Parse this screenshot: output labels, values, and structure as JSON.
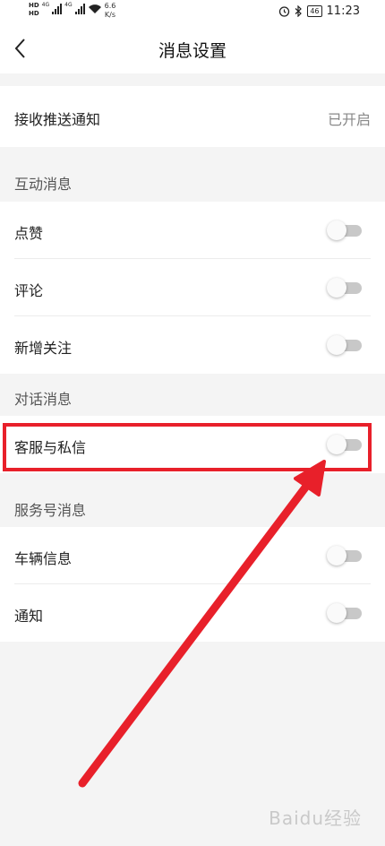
{
  "status_bar": {
    "network_label_1": "HD",
    "network_label_2": "HD",
    "signal_1": "4G",
    "signal_2": "4G",
    "speed_value": "6.6",
    "speed_unit": "K/s",
    "battery": "46",
    "time": "11:23"
  },
  "header": {
    "title": "消息设置"
  },
  "push": {
    "label": "接收推送通知",
    "value": "已开启"
  },
  "sections": {
    "interaction": {
      "title": "互动消息",
      "items": [
        {
          "label": "点赞",
          "enabled": false
        },
        {
          "label": "评论",
          "enabled": false
        },
        {
          "label": "新增关注",
          "enabled": false
        }
      ]
    },
    "conversation": {
      "title": "对话消息",
      "items": [
        {
          "label": "客服与私信",
          "enabled": false
        }
      ]
    },
    "service": {
      "title": "服务号消息",
      "items": [
        {
          "label": "车辆信息",
          "enabled": false
        },
        {
          "label": "通知",
          "enabled": false
        }
      ]
    }
  },
  "watermark": "Baidu经验",
  "colors": {
    "highlight": "#e8202a",
    "background": "#f4f4f4",
    "toggle_track_off": "#c8c8c8"
  }
}
